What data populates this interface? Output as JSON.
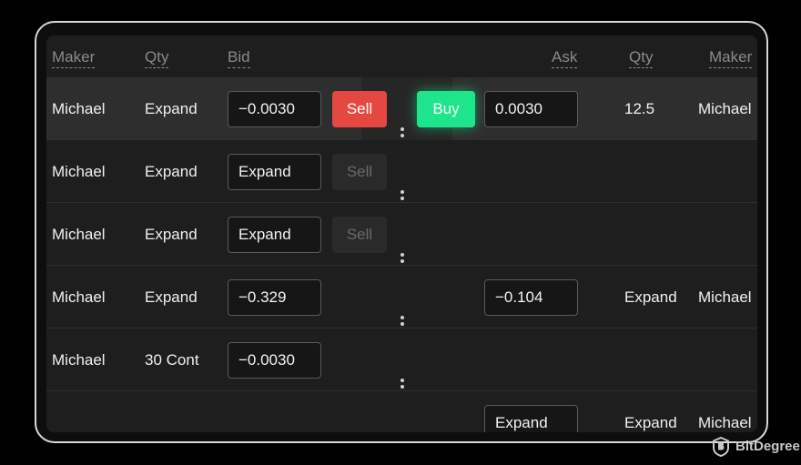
{
  "header": {
    "maker_left": "Maker",
    "qty_left": "Qty",
    "bid": "Bid",
    "ask": "Ask",
    "qty_right": "Qty",
    "maker_right": "Maker"
  },
  "rows": [
    {
      "maker": "Michael",
      "qty": "Expand",
      "bid": "−0.0030",
      "sell": "Sell",
      "buy": "Buy",
      "ask": "0.0030",
      "ask_qty": "12.5",
      "ask_maker": "Michael"
    },
    {
      "maker": "Michael",
      "qty": "Expand",
      "bid": "Expand",
      "sell": "Sell"
    },
    {
      "maker": "Michael",
      "qty": "Expand",
      "bid": "Expand",
      "sell": "Sell"
    },
    {
      "maker": "Michael",
      "qty": "Expand",
      "bid": "−0.329",
      "ask": "−0.104",
      "ask_qty": "Expand",
      "ask_maker": "Michael"
    },
    {
      "maker": "Michael",
      "qty": "30 Cont",
      "bid": "−0.0030"
    },
    {
      "ask": "Expand",
      "ask_qty": "Expand",
      "ask_maker": "Michael"
    }
  ],
  "watermark": {
    "brand": "BitDegree",
    "icon": "bitdegree-logo-icon"
  },
  "colors": {
    "sell": "#e54840",
    "buy": "#1de58c",
    "background": "#1e1e1e",
    "highlight_row": "#2e2e2e"
  }
}
